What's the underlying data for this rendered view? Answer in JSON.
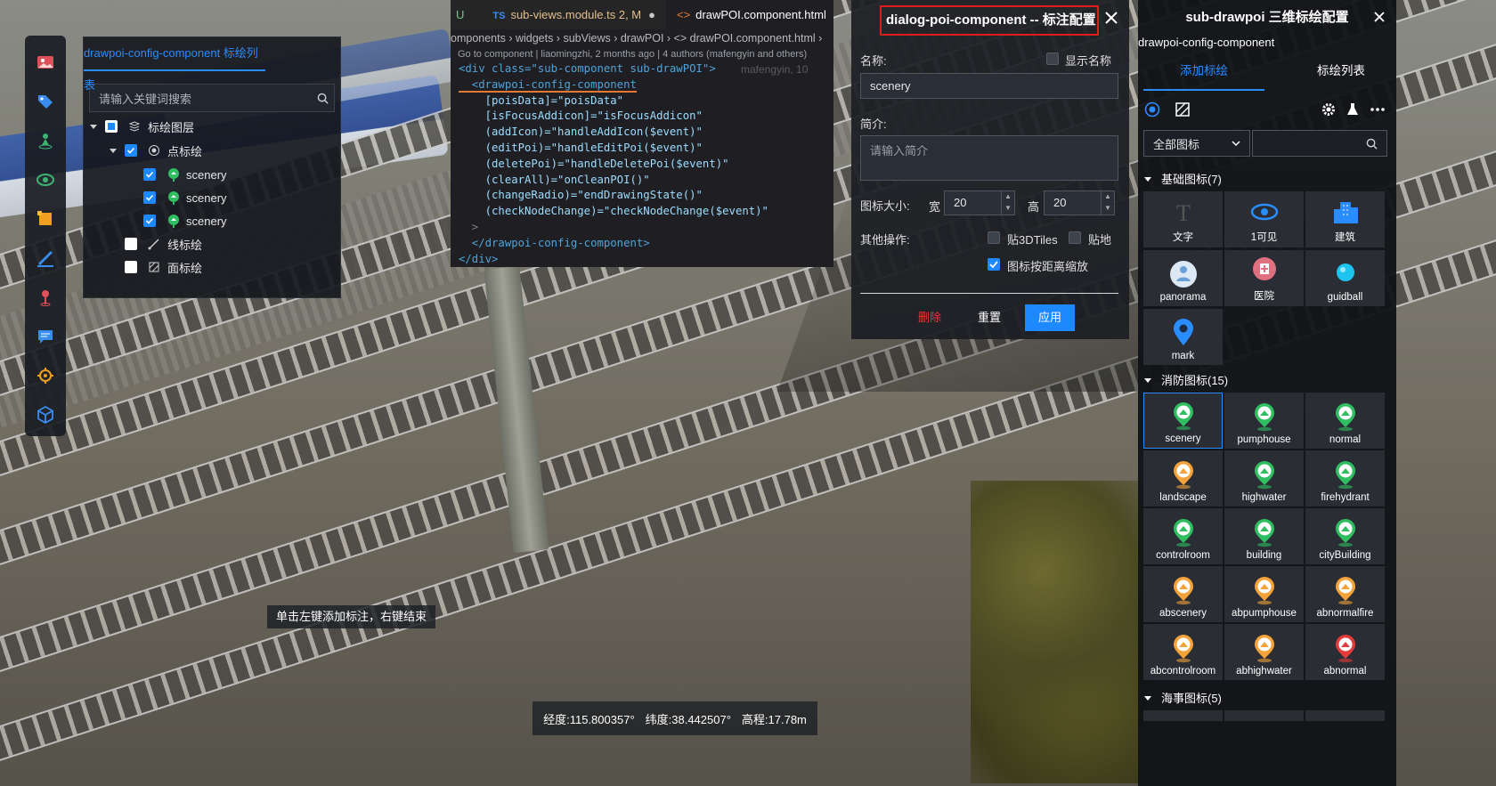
{
  "left_panel": {
    "tab": "drawpoi-config-component 标绘列表",
    "search_placeholder": "请输入关键词搜索",
    "tree": {
      "root": "标绘图层",
      "points": "点标绘",
      "items": [
        "scenery",
        "scenery",
        "scenery"
      ],
      "lines": "线标绘",
      "areas": "面标绘"
    }
  },
  "editor": {
    "tabs": [
      "U",
      "sub-views.module.ts 2, M",
      "drawPOI.component.html"
    ],
    "breadcrumb": "omponents › widgets › subViews › drawPOI › <> drawPOI.component.html ›",
    "blame": "Go to component | liaomingzhi, 2 months ago | 4 authors (mafengyin and others)",
    "inline_blame": "mafengyin, 10",
    "lines": [
      "<div class=\"sub-component sub-drawPOI\">",
      "  <drawpoi-config-component",
      "    [poisData]=\"poisData\"",
      "    [isFocusAddicon]=\"isFocusAddicon\"",
      "    (addIcon)=\"handleAddIcon($event)\"",
      "    (editPoi)=\"handleEditPoi($event)\"",
      "    (deletePoi)=\"handleDeletePoi($event)\"",
      "    (clearAll)=\"onCleanPOI()\"",
      "    (changeRadio)=\"endDrawingState()\"",
      "    (checkNodeChange)=\"checkNodeChange($event)\"",
      "  >",
      "  </drawpoi-config-component>",
      "</div>"
    ]
  },
  "dialog": {
    "title": "dialog-poi-component -- 标注配置",
    "name_label": "名称:",
    "show_name_label": "显示名称",
    "name_value": "scenery",
    "desc_label": "简介:",
    "desc_placeholder": "请输入简介",
    "size_label": "图标大小:",
    "width_label": "宽",
    "width_value": "20",
    "height_label": "高",
    "height_value": "20",
    "other_label": "其他操作:",
    "opt_3dtiles": "贴3DTiles",
    "opt_ground": "贴地",
    "opt_scale": "图标按距离缩放",
    "btn_delete": "删除",
    "btn_reset": "重置",
    "btn_apply": "应用",
    "colors": {
      "danger": "#e23b3b",
      "primary": "#1e88ff",
      "title_border": "#e21c1c"
    }
  },
  "right_panel": {
    "title": "sub-drawpoi 三维标绘配置",
    "subtitle": "drawpoi-config-component",
    "tab_add": "添加标绘",
    "tab_list": "标绘列表",
    "filter_select": "全部图标",
    "groups": [
      {
        "name": "基础图标(7)",
        "items": [
          "文字",
          "1可见",
          "建筑",
          "panorama",
          "医院",
          "guidball",
          "mark"
        ]
      },
      {
        "name": "消防图标(15)",
        "items": [
          "scenery",
          "pumphouse",
          "normal",
          "landscape",
          "highwater",
          "firehydrant",
          "controlroom",
          "building",
          "cityBuilding",
          "abscenery",
          "abpumphouse",
          "abnormalfire",
          "abcontrolroom",
          "abhighwater",
          "abnormal"
        ]
      },
      {
        "name": "海事图标(5)",
        "items": []
      }
    ]
  },
  "status": {
    "hint": "单击左键添加标注，右键结束",
    "longitude": "经度:115.800357°",
    "latitude": "纬度:38.442507°",
    "altitude": "高程:17.78m"
  }
}
